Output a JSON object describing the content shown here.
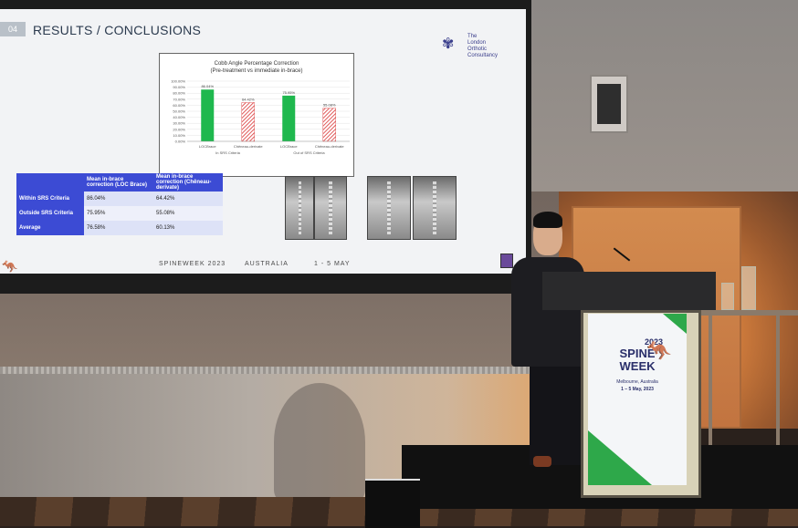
{
  "slide": {
    "section_number": "04",
    "title": "RESULTS / CONCLUSIONS",
    "logo_text": [
      "The",
      "London",
      "Orthotic",
      "Consultancy"
    ],
    "footer": {
      "event": "SPINEWEEK 2023",
      "country": "AUSTRALIA",
      "dates": "1 - 5 MAY"
    },
    "table": {
      "headers": [
        "Mean in-brace correction (LOC Brace)",
        "Mean in-brace correction (Chêneau-derivate)"
      ],
      "rows": [
        {
          "label": "Within SRS Criteria",
          "loc": "86.04%",
          "cheneau": "64.42%"
        },
        {
          "label": "Outside SRS Criteria",
          "loc": "75.95%",
          "cheneau": "55.08%"
        },
        {
          "label": "Average",
          "loc": "76.58%",
          "cheneau": "60.13%"
        }
      ]
    }
  },
  "chart_data": {
    "type": "bar",
    "title": "Cobb Angle Percentage Correction",
    "subtitle": "(Pre-treatment vs immediate in-brace)",
    "categories": [
      "LOCBrace",
      "Chêneau-derivate",
      "LOCBrace",
      "Chêneau-derivate"
    ],
    "groups": [
      "In SRS Criteria",
      "Out of SRS Criteria"
    ],
    "values": [
      86.04,
      64.42,
      75.95,
      55.08
    ],
    "data_labels": [
      "86.04%",
      "64.42%",
      "75.95%",
      "55.08%"
    ],
    "yticks": [
      "100.00%",
      "90.00%",
      "80.00%",
      "70.00%",
      "60.00%",
      "50.00%",
      "40.00%",
      "30.00%",
      "20.00%",
      "10.00%",
      "0.00%"
    ],
    "ylim": [
      0,
      100
    ],
    "colors": [
      "#1fb84e",
      "#e05a5a",
      "#1fb84e",
      "#e05a5a"
    ]
  },
  "lectern_sign": {
    "year": "2023",
    "line1": "SPINE",
    "line2": "WEEK",
    "location": "Melbourne, Australia",
    "dates": "1 – 5 May, 2023"
  }
}
